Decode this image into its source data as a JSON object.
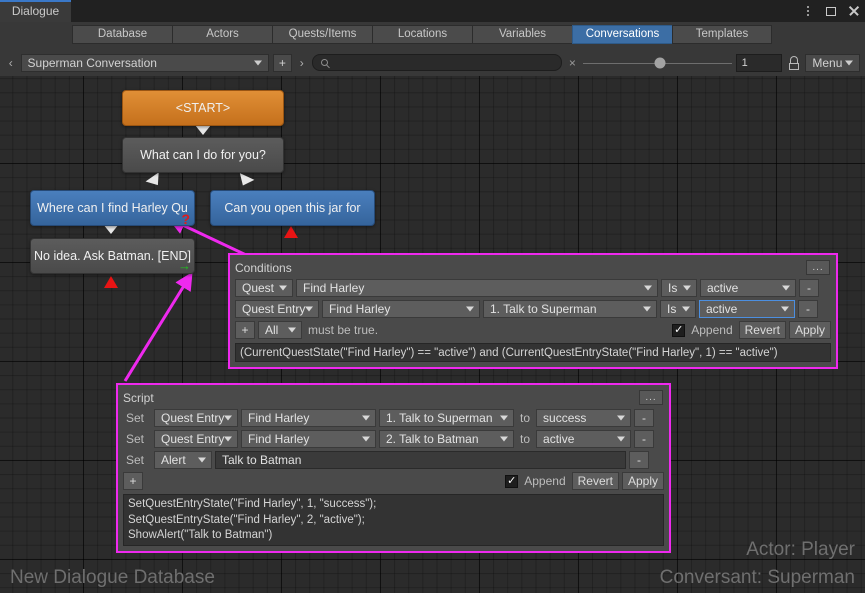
{
  "window": {
    "tab_label": "Dialogue",
    "controls": [
      "more-options",
      "maximize",
      "close"
    ]
  },
  "main_tabs": [
    {
      "label": "Database",
      "selected": false
    },
    {
      "label": "Actors",
      "selected": false
    },
    {
      "label": "Quests/Items",
      "selected": false
    },
    {
      "label": "Locations",
      "selected": false
    },
    {
      "label": "Variables",
      "selected": false
    },
    {
      "label": "Conversations",
      "selected": true
    },
    {
      "label": "Templates",
      "selected": false
    }
  ],
  "toolbar": {
    "back_chevron": "‹",
    "conversation_value": "Superman Conversation",
    "add_label": "+",
    "forward_chevron": "›",
    "search_value": "",
    "search_placeholder": "",
    "clear_label": "×",
    "zoom_value": "1",
    "menu_label": "Menu",
    "accent_color": "#3c6ea5"
  },
  "canvas": {
    "nodes": [
      {
        "id": "start",
        "text": "<START>",
        "style": "start"
      },
      {
        "id": "n1",
        "text": "What can I do for you?",
        "style": "gray"
      },
      {
        "id": "n2",
        "text": "Where can I find Harley Qu",
        "style": "blue",
        "marker": "question"
      },
      {
        "id": "n3",
        "text": "Can you open this jar for",
        "style": "blue"
      },
      {
        "id": "n4",
        "text": "No idea. Ask Batman. [END]",
        "style": "gray",
        "marker": "script-arrow"
      }
    ],
    "watermark_database": "New Dialogue Database",
    "watermark_actor": "Actor: Player",
    "watermark_conversant": "Conversant: Superman"
  },
  "conditions_panel": {
    "title": "Conditions",
    "more_label": "...",
    "rows": [
      {
        "type": "Quest",
        "target": "Find Harley",
        "entry": null,
        "comparison": "Is",
        "value": "active",
        "remove_label": "-",
        "value_selected": false
      },
      {
        "type": "Quest Entry",
        "target": "Find Harley",
        "entry": "1. Talk to Superman",
        "comparison": "Is",
        "value": "active",
        "remove_label": "-",
        "value_selected": true
      }
    ],
    "add_label": "+",
    "logic": "All",
    "logic_suffix": "must be true.",
    "append_label": "Append",
    "append_checked": true,
    "revert_label": "Revert",
    "apply_label": "Apply",
    "code": "(CurrentQuestState(\"Find Harley\") == \"active\") and (CurrentQuestEntryState(\"Find Harley\", 1) == \"active\")"
  },
  "script_panel": {
    "title": "Script",
    "more_label": "...",
    "rows": [
      {
        "set_label": "Set",
        "type": "Quest Entry",
        "target": "Find Harley",
        "entry": "1. Talk to Superman",
        "to_label": "to",
        "value": "success",
        "remove_label": "-"
      },
      {
        "set_label": "Set",
        "type": "Quest Entry",
        "target": "Find Harley",
        "entry": "2. Talk to Batman",
        "to_label": "to",
        "value": "active",
        "remove_label": "-"
      },
      {
        "set_label": "Set",
        "type": "Alert",
        "target": "Talk to Batman",
        "entry": null,
        "to_label": null,
        "value": null,
        "remove_label": "-"
      }
    ],
    "add_label": "+",
    "append_label": "Append",
    "append_checked": true,
    "revert_label": "Revert",
    "apply_label": "Apply",
    "code": "SetQuestEntryState(\"Find Harley\", 1, \"success\");\nSetQuestEntryState(\"Find Harley\", 2, \"active\");\nShowAlert(\"Talk to Batman\")"
  },
  "colors": {
    "panel_outline": "#ee29ee",
    "node_start": "#d4812c",
    "node_blue": "#3f72ad",
    "node_gray": "#515151",
    "marker_red": "#e81414",
    "marker_green": "#1ec41e"
  }
}
